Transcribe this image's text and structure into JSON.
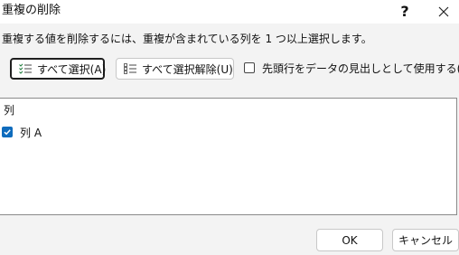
{
  "window": {
    "title": "重複の削除",
    "help_icon": "question-mark-icon",
    "close_icon": "close-icon"
  },
  "instruction": "重複する値を削除するには、重複が含まれている列を 1 つ以上選択します。",
  "actions": {
    "select_all": {
      "label": "すべて選択(A)",
      "icon": "select-all-list-icon"
    },
    "deselect_all": {
      "label": "すべて選択解除(U)",
      "icon": "deselect-all-list-icon"
    },
    "header_option": {
      "label": "先頭行をデータの見出しとして使用する(M)",
      "checked": false
    }
  },
  "column_list": {
    "header": "列",
    "items": [
      {
        "label": "列 A",
        "checked": true
      }
    ]
  },
  "buttons": {
    "ok": "OK",
    "cancel": "キャンセル"
  },
  "colors": {
    "dialog_background": "#f3f3f3",
    "white_surface": "#ffffff",
    "accent_blue": "#0f6cbd",
    "primary_button_border": "#1f1f1f"
  }
}
